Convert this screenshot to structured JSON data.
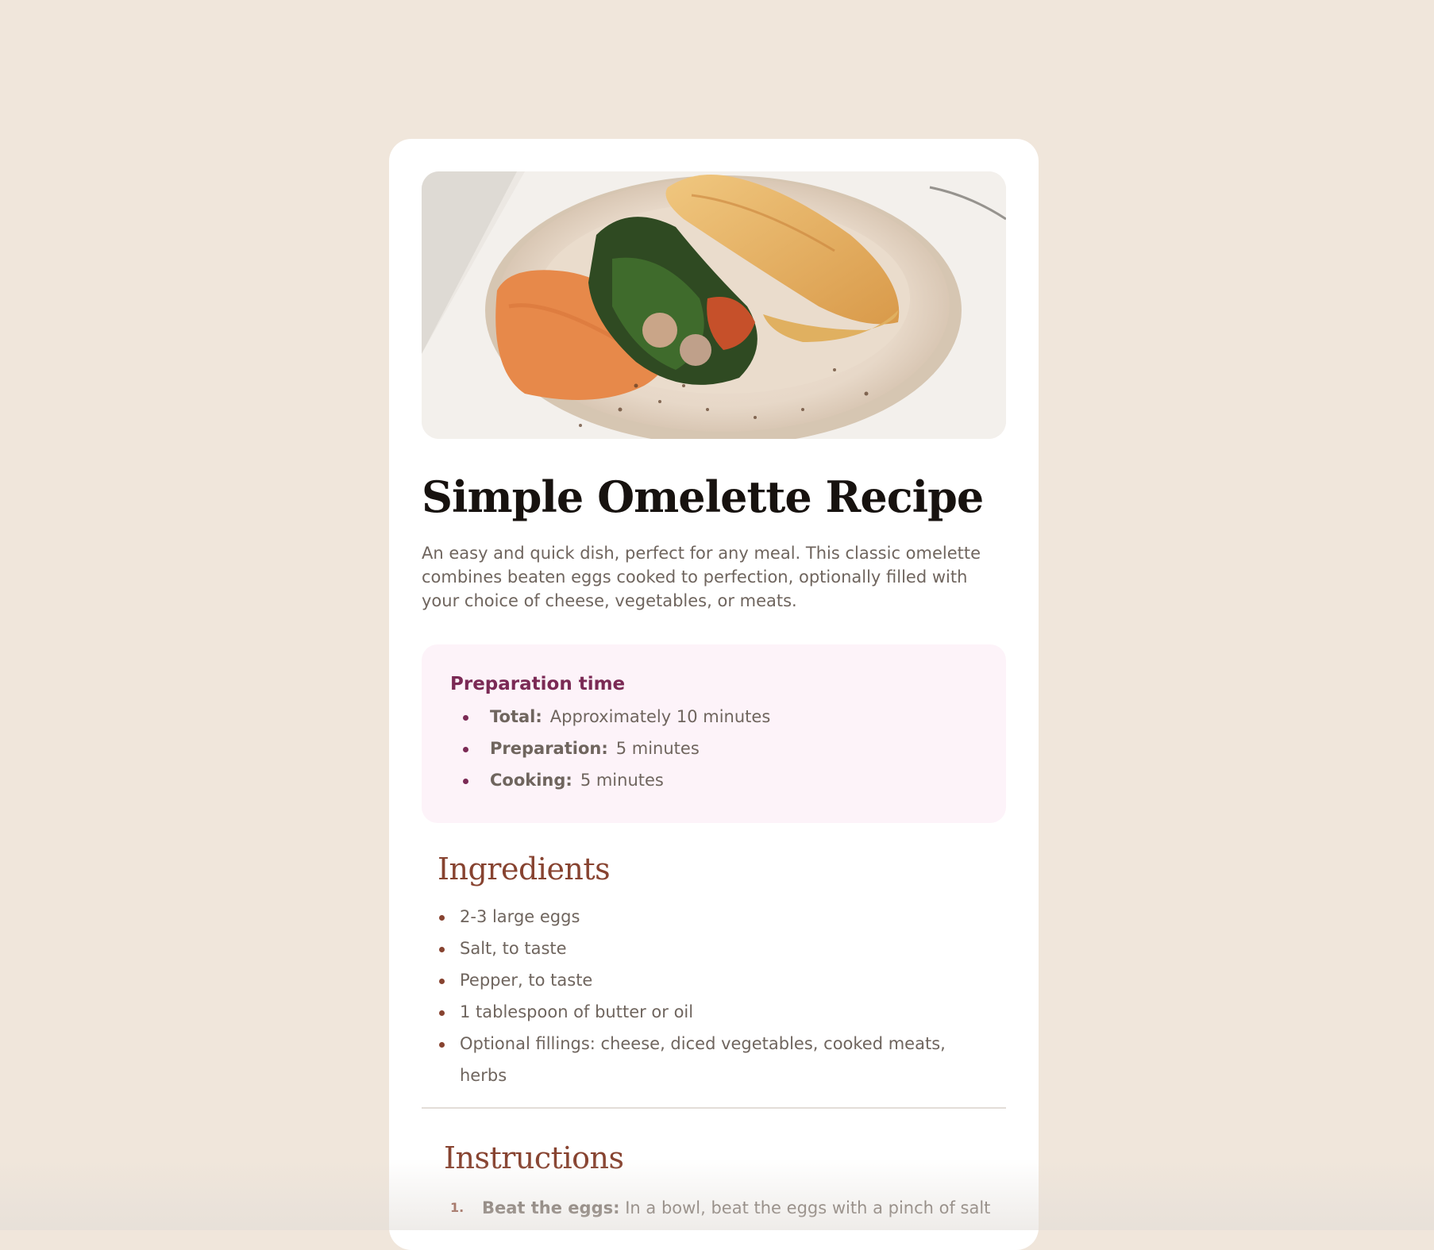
{
  "recipe": {
    "image_alt": "omelette-photo",
    "title": "Simple Omelette Recipe",
    "description": "An easy and quick dish, perfect for any meal. This classic omelette combines beaten eggs cooked to perfection, optionally filled with your choice of cheese, vegetables, or meats."
  },
  "prep": {
    "heading": "Preparation time",
    "items": [
      {
        "label": "Total:",
        "value": "Approximately 10 minutes"
      },
      {
        "label": "Preparation:",
        "value": "5 minutes"
      },
      {
        "label": "Cooking:",
        "value": "5 minutes"
      }
    ]
  },
  "ingredients": {
    "heading": "Ingredients",
    "items": [
      "2-3 large eggs",
      "Salt, to taste",
      "Pepper, to taste",
      "1 tablespoon of butter or oil",
      "Optional fillings: cheese, diced vegetables, cooked meats, herbs"
    ]
  },
  "instructions": {
    "heading": "Instructions",
    "items": [
      {
        "num": "1.",
        "label": "Beat the eggs:",
        "text": "In a bowl, beat the eggs with a pinch of salt"
      }
    ]
  },
  "colors": {
    "page_bg": "#f0e6db",
    "accent_brown": "#874330",
    "accent_plum": "#7b2a55",
    "prep_bg": "#fdf3f9"
  }
}
